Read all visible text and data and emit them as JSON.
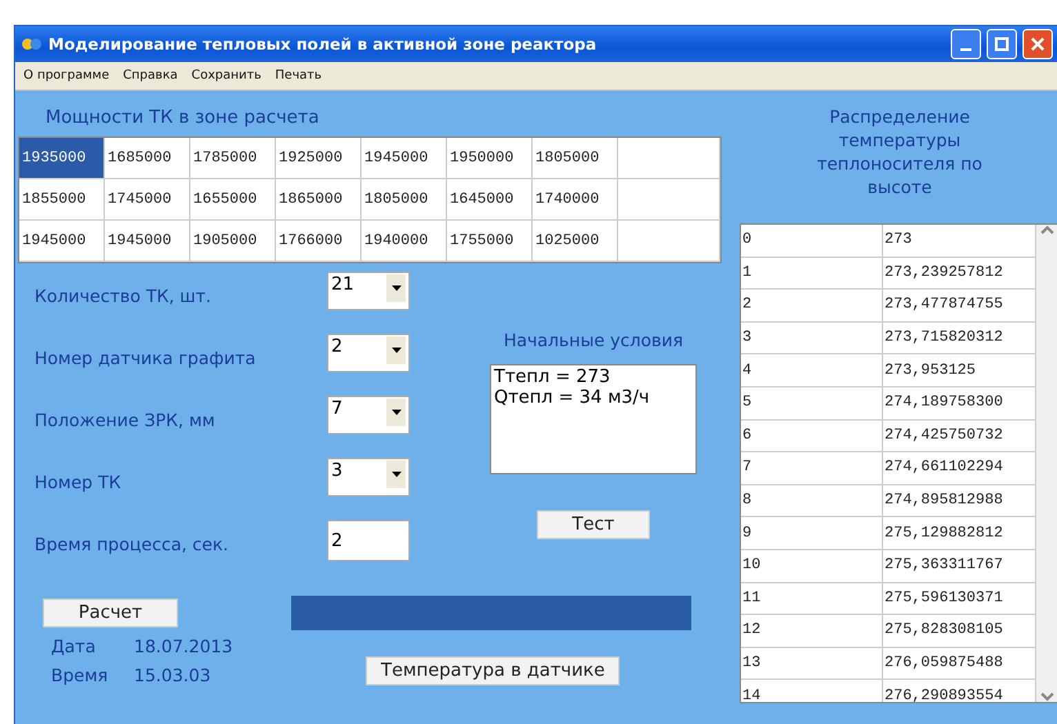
{
  "window": {
    "title": "Моделирование тепловых полей в активной зоне реактора"
  },
  "menu": [
    "О программе",
    "Справка",
    "Сохранить",
    "Печать"
  ],
  "power_grid": {
    "heading": "Мощности ТК в зоне расчета",
    "rows": [
      [
        {
          "text": "1935000",
          "selected": true
        },
        {
          "text": "1685000",
          "selected": false
        },
        {
          "text": "1785000",
          "selected": false
        },
        {
          "text": "1925000",
          "selected": false
        },
        {
          "text": "1945000",
          "selected": false
        },
        {
          "text": "1950000",
          "selected": false
        },
        {
          "text": "1805000",
          "selected": false
        }
      ],
      [
        {
          "text": "1855000",
          "selected": false
        },
        {
          "text": "1745000",
          "selected": false
        },
        {
          "text": "1655000",
          "selected": false
        },
        {
          "text": "1865000",
          "selected": false
        },
        {
          "text": "1805000",
          "selected": false
        },
        {
          "text": "1645000",
          "selected": false
        },
        {
          "text": "1740000",
          "selected": false
        }
      ],
      [
        {
          "text": "1945000",
          "selected": false
        },
        {
          "text": "1945000",
          "selected": false
        },
        {
          "text": "1905000",
          "selected": false
        },
        {
          "text": "1766000",
          "selected": false
        },
        {
          "text": "1940000",
          "selected": false
        },
        {
          "text": "1755000",
          "selected": false
        },
        {
          "text": "1025000",
          "selected": false
        }
      ]
    ]
  },
  "params": [
    {
      "label": "Количество ТК, шт.",
      "kind": "combo",
      "value": "21"
    },
    {
      "label": "Номер датчика графита",
      "kind": "combo",
      "value": "2"
    },
    {
      "label": "Положение ЗРК, мм",
      "kind": "combo",
      "value": "7"
    },
    {
      "label": "Номер ТК",
      "kind": "combo",
      "value": "3"
    },
    {
      "label": "Время процесса, сек.",
      "kind": "input",
      "value": "2"
    }
  ],
  "initial_conditions": {
    "heading": "Начальные условия",
    "lines": [
      "Ттепл = 273",
      "Qтепл = 34 м3/ч"
    ]
  },
  "test_button": "Тест",
  "calc_button": "Расчет",
  "date": {
    "label": "Дата",
    "value": "18.07.2013"
  },
  "time": {
    "label": "Время",
    "value": "15.03.03"
  },
  "sensor_button": "Температура в датчике",
  "distribution": {
    "heading": "Распределение температуры теплоносителя по высоте",
    "rows": [
      [
        "0",
        "273"
      ],
      [
        "1",
        "273,239257812"
      ],
      [
        "2",
        "273,477874755"
      ],
      [
        "3",
        "273,715820312"
      ],
      [
        "4",
        "273,953125"
      ],
      [
        "5",
        "274,189758300"
      ],
      [
        "6",
        "274,425750732"
      ],
      [
        "7",
        "274,661102294"
      ],
      [
        "8",
        "274,895812988"
      ],
      [
        "9",
        "275,129882812"
      ],
      [
        "10",
        "275,363311767"
      ],
      [
        "11",
        "275,596130371"
      ],
      [
        "12",
        "275,828308105"
      ],
      [
        "13",
        "276,059875488"
      ],
      [
        "14",
        "276,290893554"
      ]
    ]
  }
}
